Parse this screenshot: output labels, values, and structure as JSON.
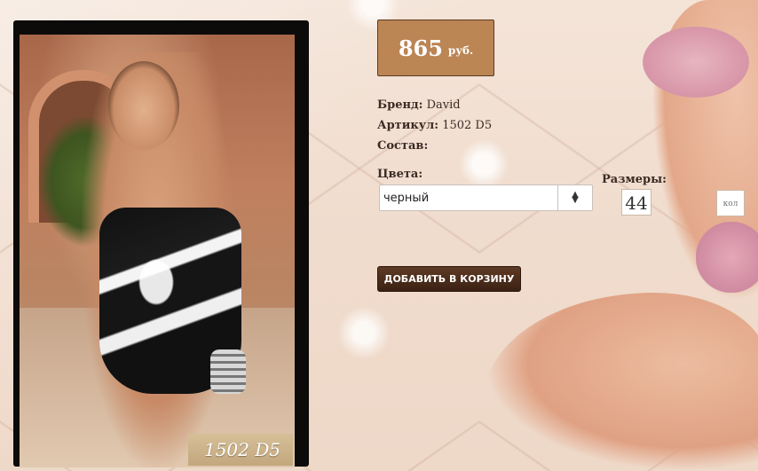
{
  "product": {
    "price": "865",
    "currency": "руб.",
    "brand_label": "Бренд:",
    "brand": "David",
    "article_label": "Артикул:",
    "article": "1502 D5",
    "composition_label": "Состав:",
    "composition": "",
    "photo_caption": "1502 D5"
  },
  "options": {
    "colors_label": "Цвета:",
    "color_selected": "черный",
    "sizes_label": "Размеры:",
    "size": "44",
    "qty_placeholder": "кол"
  },
  "actions": {
    "add_to_cart": "ДОБАВИТЬ В КОРЗИНУ"
  },
  "icons": {
    "select_arrows": "updown-chevron-icon"
  }
}
